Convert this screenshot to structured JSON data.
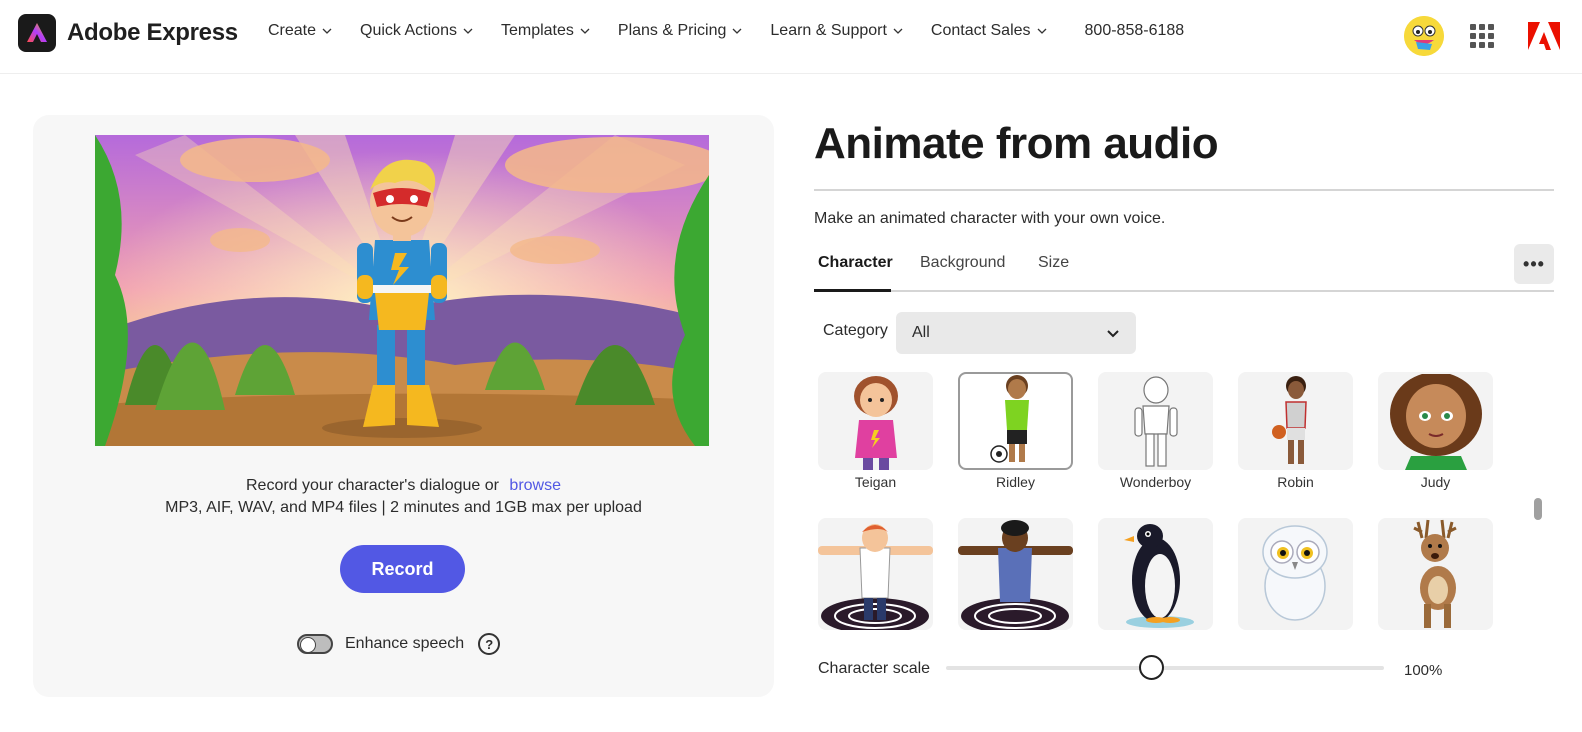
{
  "header": {
    "brand_name": "Adobe Express",
    "nav": [
      {
        "label": "Create"
      },
      {
        "label": "Quick Actions"
      },
      {
        "label": "Templates"
      },
      {
        "label": "Plans & Pricing"
      },
      {
        "label": "Learn & Support"
      },
      {
        "label": "Contact Sales"
      }
    ],
    "phone": "800-858-6188",
    "icons": {
      "avatar": "avatar-icon",
      "apps": "apps-grid-icon",
      "adobe": "adobe-logo-icon"
    }
  },
  "preview": {
    "record_prompt": "Record your character's dialogue or",
    "browse_label": "browse",
    "file_info": "MP3, AIF, WAV, and MP4 files | 2 minutes and 1GB max per upload",
    "record_label": "Record",
    "enhance_label": "Enhance speech",
    "help_glyph": "?"
  },
  "panel": {
    "title": "Animate from audio",
    "subtitle": "Make an animated character with your own voice.",
    "tabs": [
      {
        "label": "Character"
      },
      {
        "label": "Background"
      },
      {
        "label": "Size"
      }
    ],
    "more_glyph": "•••",
    "category_label": "Category",
    "category_value": "All",
    "characters": [
      {
        "name": "Teigan"
      },
      {
        "name": "Ridley"
      },
      {
        "name": "Wonderboy"
      },
      {
        "name": "Robin"
      },
      {
        "name": "Judy"
      }
    ],
    "scale_label": "Character scale",
    "scale_value": "100%",
    "scale_fraction": 0.47
  },
  "colors": {
    "accent": "#5258e4",
    "brand_bg": "#1a1a1a",
    "adobe_red": "#eb1000"
  }
}
